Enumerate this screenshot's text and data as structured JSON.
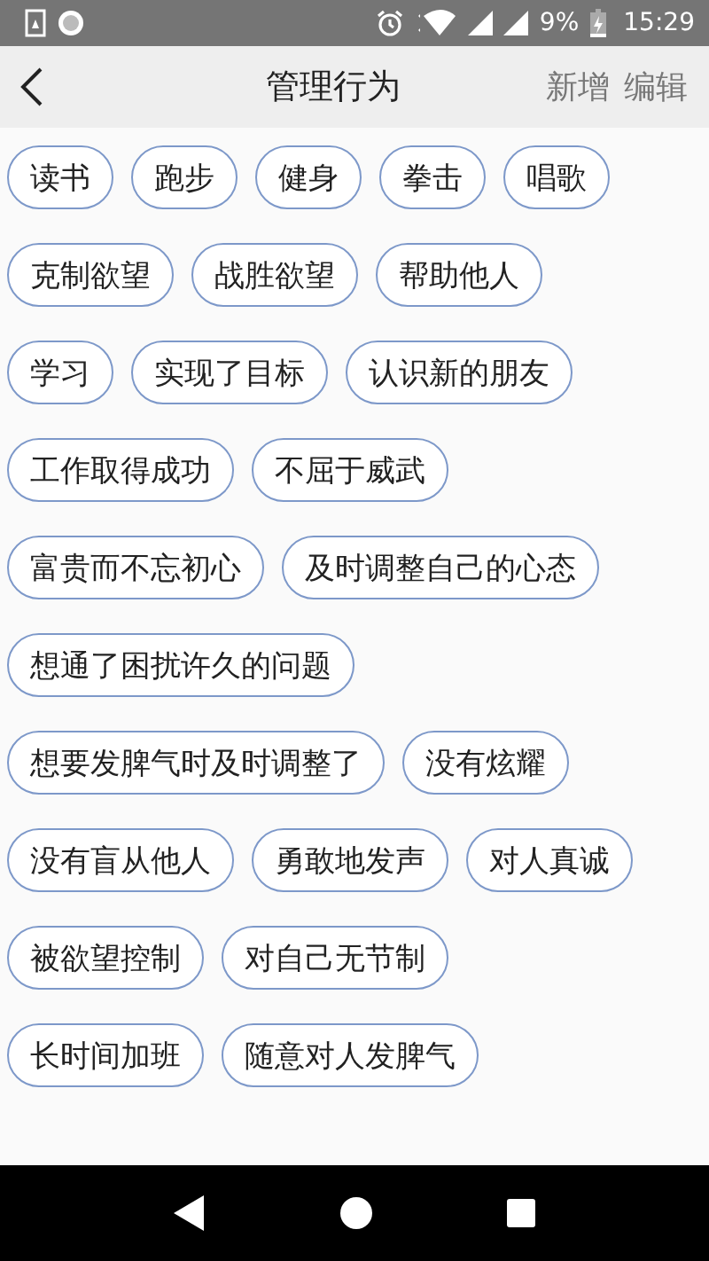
{
  "status_bar": {
    "battery": "9%",
    "time": "15:29"
  },
  "header": {
    "title": "管理行为",
    "actions": [
      "新增",
      "编辑"
    ]
  },
  "tag_rows": [
    [
      "读书",
      "跑步",
      "健身",
      "拳击",
      "唱歌"
    ],
    [
      "克制欲望",
      "战胜欲望",
      "帮助他人"
    ],
    [
      "学习",
      "实现了目标",
      "认识新的朋友"
    ],
    [
      "工作取得成功",
      "不屈于威武"
    ],
    [
      "富贵而不忘初心",
      "及时调整自己的心态"
    ],
    [
      "想通了困扰许久的问题"
    ],
    [
      "想要发脾气时及时调整了",
      "没有炫耀"
    ],
    [
      "没有盲从他人",
      "勇敢地发声",
      "对人真诚"
    ],
    [
      "被欲望控制",
      "对自己无节制"
    ],
    [
      "长时间加班",
      "随意对人发脾气"
    ]
  ]
}
